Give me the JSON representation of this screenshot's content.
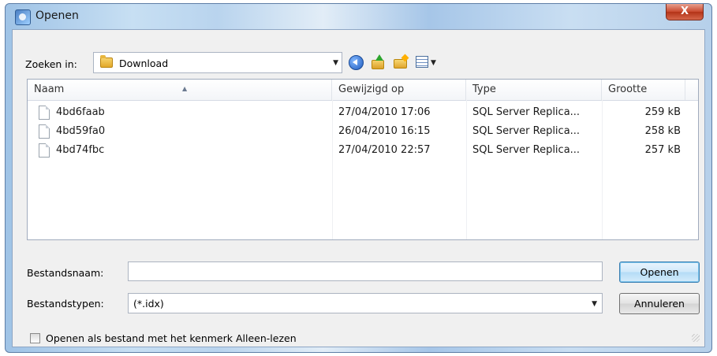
{
  "window": {
    "title": "Openen",
    "close_glyph": "X"
  },
  "toolbar": {
    "lookin_label": "Zoeken in:",
    "lookin_value": "Download",
    "icons": [
      "back-icon",
      "up-folder-icon",
      "new-folder-icon",
      "views-menu-icon"
    ]
  },
  "filelist": {
    "columns": [
      "Naam",
      "Gewijzigd op",
      "Type",
      "Grootte"
    ],
    "rows": [
      {
        "name": "4bd6faab",
        "modified": "27/04/2010 17:06",
        "type": "SQL Server Replica...",
        "size": "259 kB"
      },
      {
        "name": "4bd59fa0",
        "modified": "26/04/2010 16:15",
        "type": "SQL Server Replica...",
        "size": "258 kB"
      },
      {
        "name": "4bd74fbc",
        "modified": "27/04/2010 22:57",
        "type": "SQL Server Replica...",
        "size": "257 kB"
      }
    ]
  },
  "form": {
    "filename_label": "Bestandsnaam:",
    "filename_value": "",
    "filetype_label": "Bestandstypen:",
    "filetype_value": "(*.idx)",
    "open_button": "Openen",
    "cancel_button": "Annuleren",
    "readonly_label": "Openen als bestand met het kenmerk Alleen-lezen"
  },
  "colors": {
    "title_bar": "#b9d4ee",
    "close_red": "#c9492e",
    "dialog_bg": "#f0f0f0"
  }
}
